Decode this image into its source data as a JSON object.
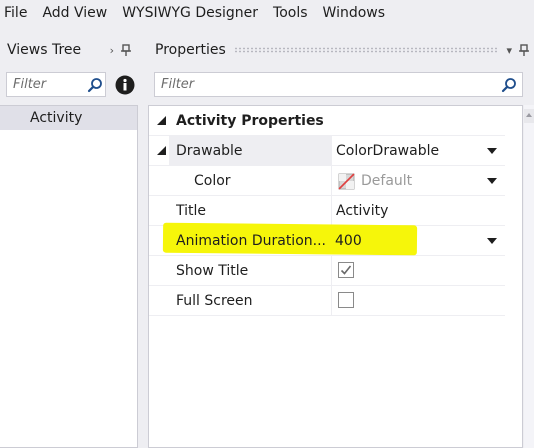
{
  "menu": [
    "File",
    "Add View",
    "WYSIWYG Designer",
    "Tools",
    "Windows"
  ],
  "views_tree": {
    "title": "Views Tree",
    "filter_placeholder": "Filter",
    "items": [
      "Activity"
    ]
  },
  "properties": {
    "title": "Properties",
    "filter_placeholder": "Filter",
    "category": "Activity Properties",
    "rows": {
      "drawable": {
        "name": "Drawable",
        "value": "ColorDrawable"
      },
      "color": {
        "name": "Color",
        "value": "Default"
      },
      "title": {
        "name": "Title",
        "value": "Activity"
      },
      "animation": {
        "name": "Animation Duration...",
        "value": "400"
      },
      "show_title": {
        "name": "Show Title",
        "checked": true
      },
      "full_screen": {
        "name": "Full Screen",
        "checked": false
      }
    }
  },
  "colors": {
    "highlight": "#f6f60a",
    "selected_row": "#e0e0e8"
  },
  "icons": [
    "search-icon",
    "info-icon",
    "pin-icon",
    "dropdown-caret-icon",
    "checkmark-icon",
    "color-swatch-icon"
  ]
}
